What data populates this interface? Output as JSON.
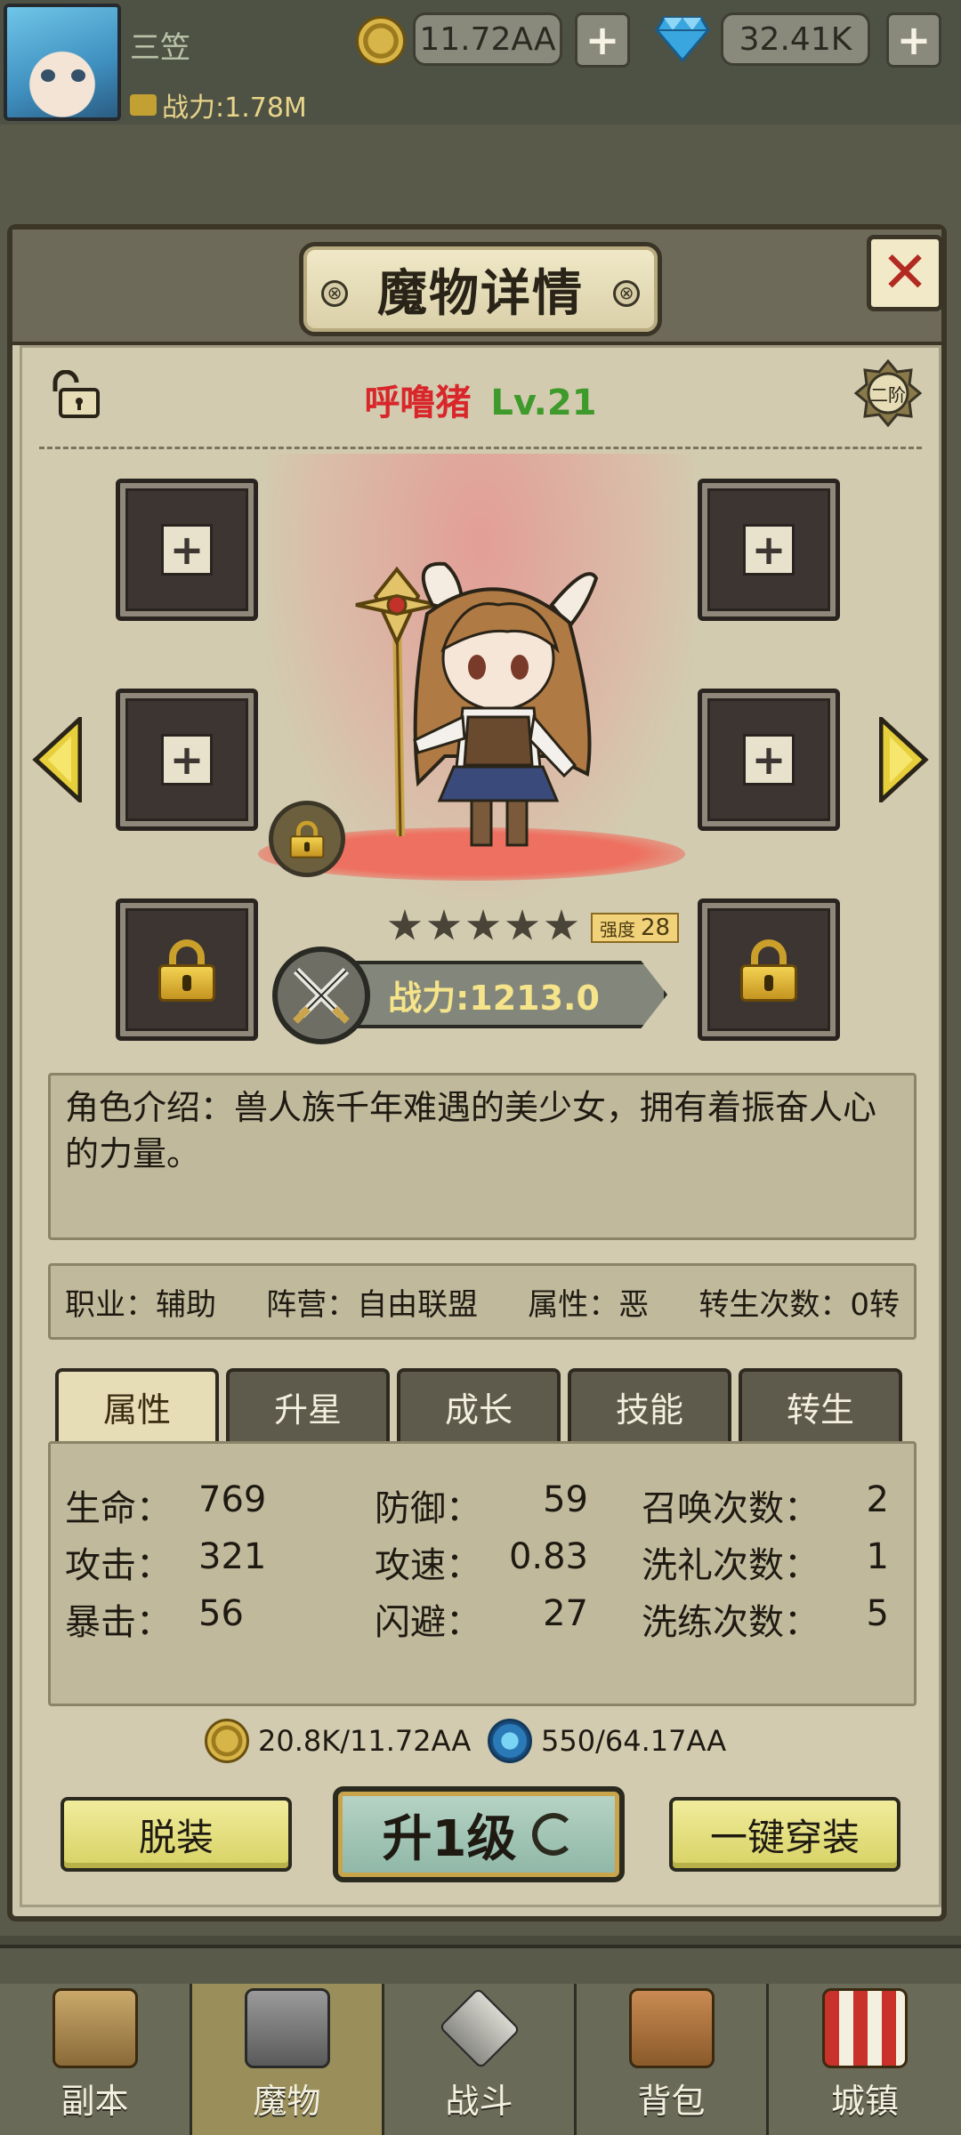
{
  "topbar": {
    "player_name": "三笠",
    "power": "战力:1.78M",
    "gold": "11.72AA",
    "gems": "32.41K"
  },
  "panel": {
    "title": "魔物详情",
    "monster_name": "呼噜猪",
    "monster_level": "Lv.21",
    "rank_badge": "二阶",
    "stars_count": 5,
    "strength_label": "强度",
    "strength_value": "28",
    "power_label": "战力:1213.0",
    "description": "角色介绍：兽人族千年难遇的美少女，拥有着振奋人心的力量。",
    "info": {
      "job": "职业：辅助",
      "faction": "阵营：自由联盟",
      "attribute": "属性：恶",
      "rebirth": "转生次数：0转"
    },
    "tabs": [
      "属性",
      "升星",
      "成长",
      "技能",
      "转生"
    ],
    "active_tab": 0,
    "stats": [
      {
        "label": "生命：",
        "value": "769"
      },
      {
        "label": "攻击：",
        "value": "321"
      },
      {
        "label": "暴击：",
        "value": "56"
      },
      {
        "label": "防御：",
        "value": "59"
      },
      {
        "label": "攻速：",
        "value": "0.83"
      },
      {
        "label": "闪避：",
        "value": "27"
      },
      {
        "label": "召唤次数：",
        "value": "2"
      },
      {
        "label": "洗礼次数：",
        "value": "1"
      },
      {
        "label": "洗练次数：",
        "value": "5"
      }
    ],
    "cost_gold": "20.8K/11.72AA",
    "cost_essence": "550/64.17AA",
    "unequip_label": "脱装",
    "upgrade_label": "升1级",
    "equip_all_label": "一键穿装"
  },
  "nav": [
    "副本",
    "魔物",
    "战斗",
    "背包",
    "城镇"
  ],
  "nav_active": 1,
  "colors": {
    "name_red": "#d8262a",
    "level_green": "#3e9a2a",
    "power_gold": "#f5e48a",
    "close_red": "#b22a22"
  }
}
